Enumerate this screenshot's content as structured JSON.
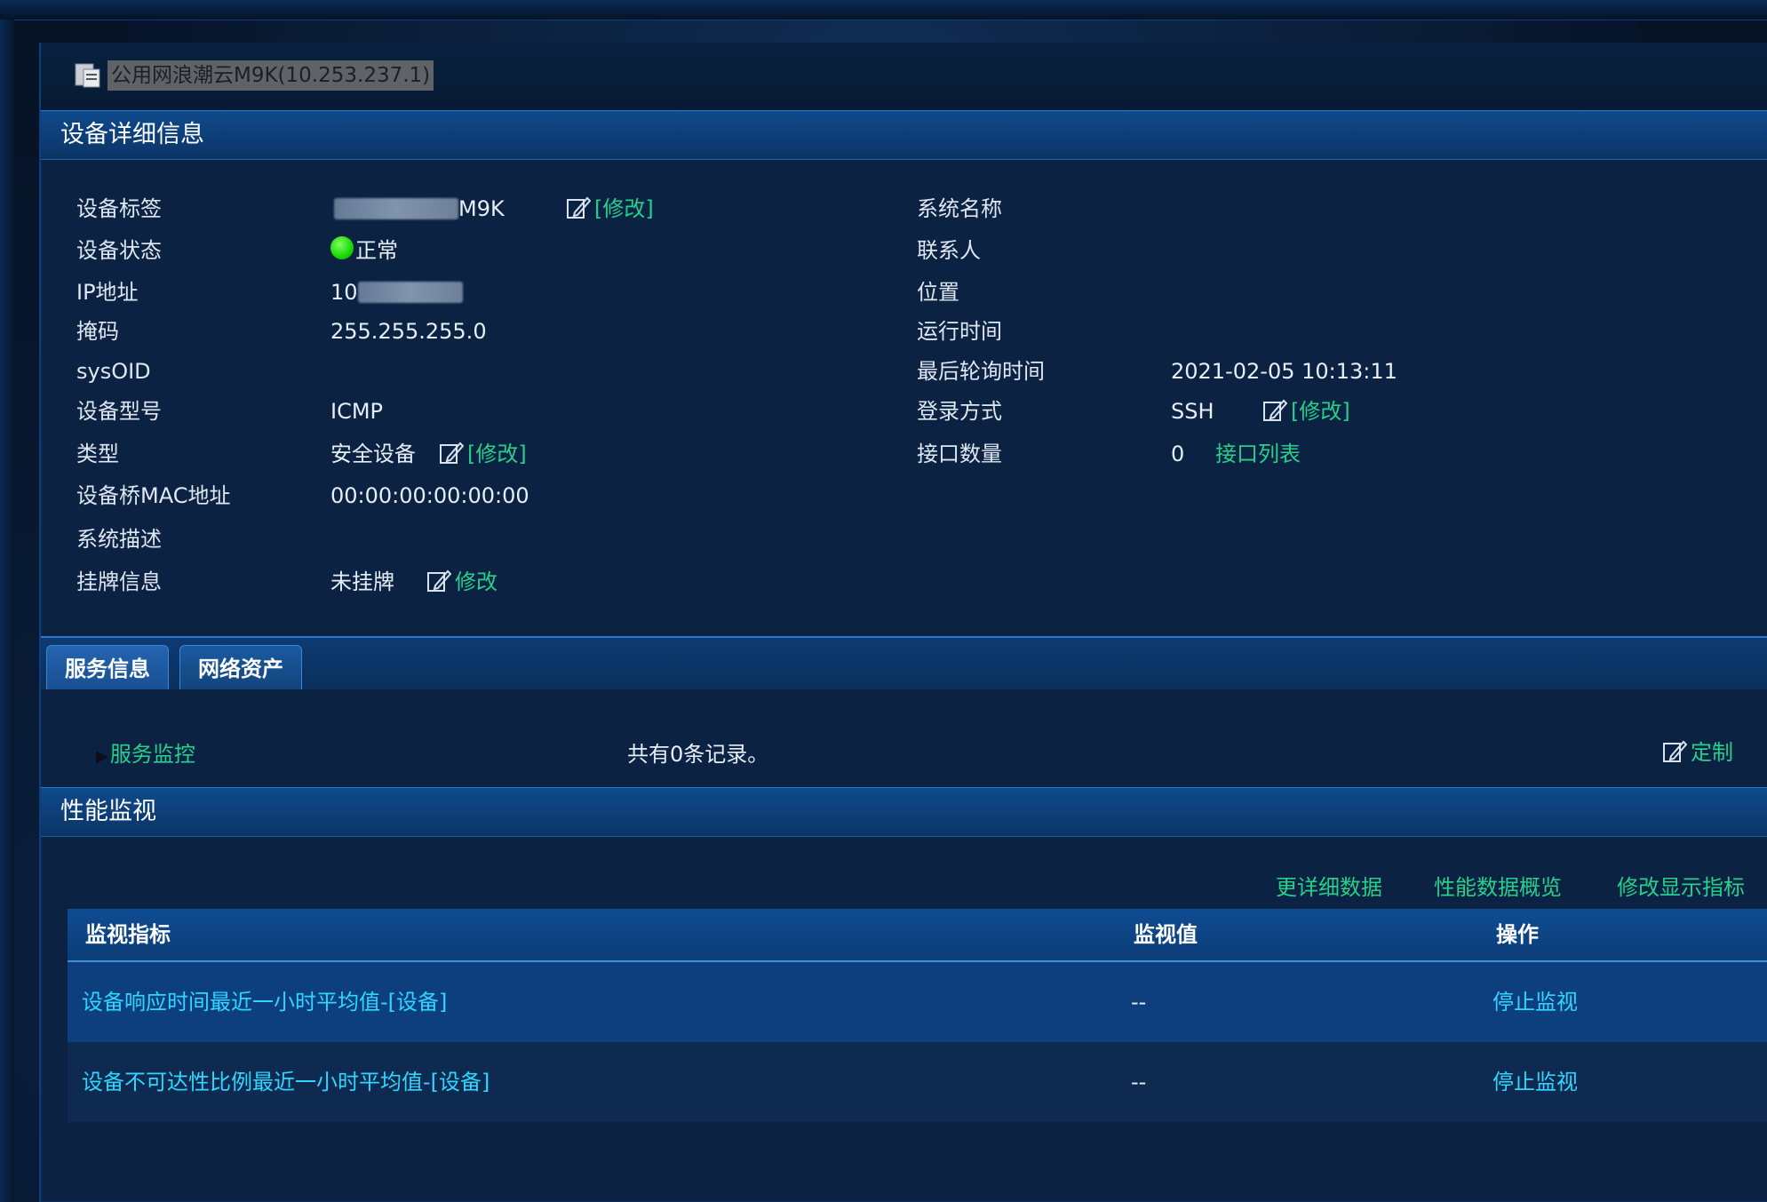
{
  "window": {
    "title": "公用网浪潮云M9K(10.253.237.1)"
  },
  "device_detail": {
    "section_title": "设备详细信息",
    "left": [
      {
        "label": "设备标签",
        "value": "M9K",
        "action": "[修改]"
      },
      {
        "label": "设备状态",
        "value": "正常"
      },
      {
        "label": "IP地址",
        "value": "10"
      },
      {
        "label": "掩码",
        "value": "255.255.255.0"
      },
      {
        "label": "sysOID",
        "value": ""
      },
      {
        "label": "设备型号",
        "value": "ICMP"
      },
      {
        "label": "类型",
        "value": "安全设备",
        "action": "[修改]"
      },
      {
        "label": "设备桥MAC地址",
        "value": "00:00:00:00:00:00"
      },
      {
        "label": "系统描述",
        "value": ""
      },
      {
        "label": "挂牌信息",
        "value": "未挂牌",
        "action": "修改"
      }
    ],
    "right": [
      {
        "label": "系统名称",
        "value": ""
      },
      {
        "label": "联系人",
        "value": ""
      },
      {
        "label": "位置",
        "value": ""
      },
      {
        "label": "运行时间",
        "value": ""
      },
      {
        "label": "最后轮询时间",
        "value": "2021-02-05 10:13:11"
      },
      {
        "label": "登录方式",
        "value": "SSH",
        "action": "[修改]"
      },
      {
        "label": "接口数量",
        "value": "0",
        "action": "接口列表"
      }
    ]
  },
  "tabs": [
    {
      "label": "服务信息",
      "active": true
    },
    {
      "label": "网络资产",
      "active": false
    }
  ],
  "service": {
    "monitor_link": "服务监控",
    "record_text": "共有0条记录。",
    "customize": "定制"
  },
  "performance": {
    "section_title": "性能监视",
    "links": [
      "更详细数据",
      "性能数据概览",
      "修改显示指标"
    ],
    "columns": [
      "监视指标",
      "监视值",
      "操作"
    ],
    "rows": [
      {
        "metric": "设备响应时间最近一小时平均值-[设备]",
        "value": "--",
        "action": "停止监视"
      },
      {
        "metric": "设备不可达性比例最近一小时平均值-[设备]",
        "value": "--",
        "action": "停止监视"
      }
    ]
  },
  "colors": {
    "background": "#071428",
    "panel": "#0b2243",
    "link_green": "#26d08b",
    "link_cyan": "#2fd6ff",
    "status_ok": "#17d800"
  }
}
